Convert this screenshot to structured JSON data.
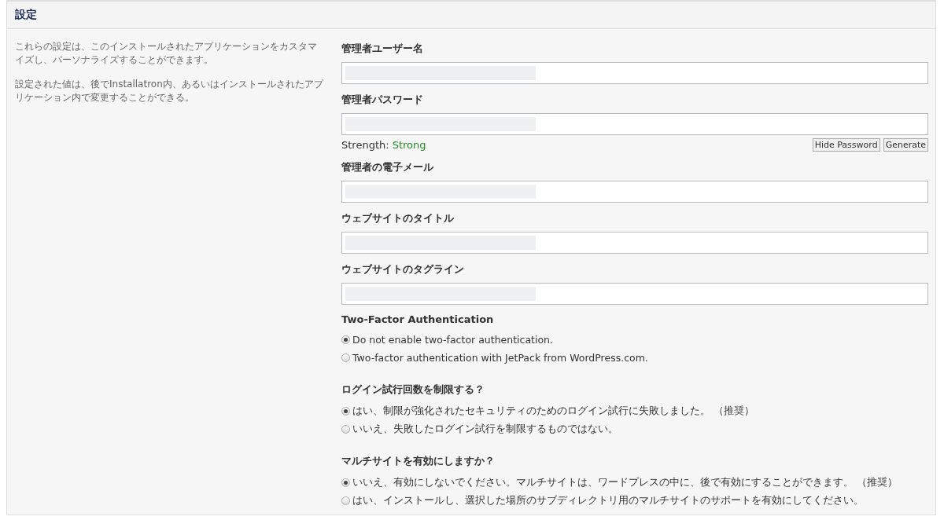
{
  "header": {
    "title": "設定"
  },
  "description": [
    "これらの設定は、このインストールされたアプリケーションをカスタマイズし、パーソナライズすることができます。",
    "設定された値は、後でInstallatron内、あるいはインストールされたアプリケーション内で変更することができる。"
  ],
  "fields": [
    {
      "label": "管理者ユーザー名",
      "kind": "text"
    },
    {
      "label": "管理者パスワード",
      "kind": "password",
      "strength_label": "Strength:",
      "strength": "Strong",
      "buttons": [
        "Hide Password",
        "Generate"
      ]
    },
    {
      "label": "管理者の電子メール",
      "kind": "text"
    },
    {
      "label": "ウェブサイトのタイトル",
      "kind": "text"
    },
    {
      "label": "ウェブサイトのタグライン",
      "kind": "text"
    }
  ],
  "radio_groups": [
    {
      "label": "Two-Factor Authentication",
      "options": [
        {
          "label": "Do not enable two-factor authentication.",
          "selected": true
        },
        {
          "label": "Two-factor authentication with JetPack from WordPress.com.",
          "selected": false
        }
      ]
    },
    {
      "label": "ログイン試行回数を制限する？",
      "options": [
        {
          "label": "はい、制限が強化されたセキュリティのためのログイン試行に失敗しました。 （推奨）",
          "selected": true
        },
        {
          "label": "いいえ、失敗したログイン試行を制限するものではない。",
          "selected": false
        }
      ]
    },
    {
      "label": "マルチサイトを有効にしますか？",
      "options": [
        {
          "label": "いいえ、有効にしないでください。マルチサイトは、ワードプレスの中に、後で有効にすることができます。 （推奨）",
          "selected": true
        },
        {
          "label": "はい、インストールし、選択した場所のサブディレクトリ用のマルチサイトのサポートを有効にしてください。",
          "selected": false
        }
      ]
    }
  ]
}
